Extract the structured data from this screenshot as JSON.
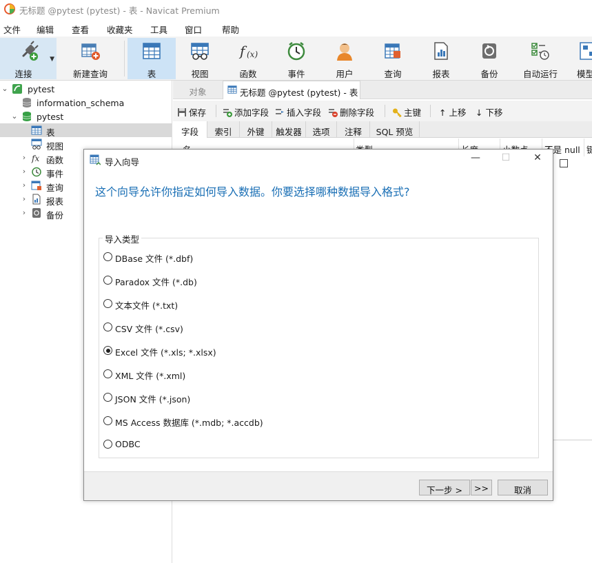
{
  "window": {
    "title": "无标题 @pytest (pytest) - 表 - Navicat Premium"
  },
  "menu": [
    "文件",
    "编辑",
    "查看",
    "收藏夹",
    "工具",
    "窗口",
    "帮助"
  ],
  "toolbar": {
    "connect": "连接",
    "new_query": "新建查询",
    "table": "表",
    "view": "视图",
    "function": "函数",
    "event": "事件",
    "user": "用户",
    "query": "查询",
    "report": "报表",
    "backup": "备份",
    "auto_run": "自动运行",
    "model": "模型"
  },
  "sidebar": {
    "conn": "pytest",
    "schema1": "information_schema",
    "schema2": "pytest",
    "table": "表",
    "view": "视图",
    "function": "函数",
    "event": "事件",
    "query": "查询",
    "report": "报表",
    "backup": "备份"
  },
  "tabs": {
    "objects": "对象",
    "doc": "无标题 @pytest (pytest) - 表"
  },
  "design_toolbar": {
    "save": "保存",
    "add_field": "添加字段",
    "insert_field": "插入字段",
    "delete_field": "删除字段",
    "primary_key": "主键",
    "move_up": "上移",
    "move_down": "下移"
  },
  "design_tabs": [
    "字段",
    "索引",
    "外键",
    "触发器",
    "选项",
    "注释",
    "SQL 预览"
  ],
  "grid": {
    "col_name": "名",
    "col_type": "类型",
    "col_length": "长度",
    "col_decimal": "小数点",
    "col_notnull": "不是 null",
    "col_key": "键"
  },
  "dialog": {
    "title": "导入向导",
    "heading": "这个向导允许你指定如何导入数据。你要选择哪种数据导入格式?",
    "group_label": "导入类型",
    "options": [
      "DBase 文件 (*.dbf)",
      "Paradox 文件 (*.db)",
      "文本文件 (*.txt)",
      "CSV 文件 (*.csv)",
      "Excel 文件 (*.xls; *.xlsx)",
      "XML 文件 (*.xml)",
      "JSON 文件 (*.json)",
      "MS Access 数据库 (*.mdb; *.accdb)",
      "ODBC"
    ],
    "selected_option": "Excel 文件 (*.xls; *.xlsx)",
    "next": "下一步 >",
    "finish": ">>",
    "cancel": "取消",
    "minimize": "—",
    "maximize": "☐",
    "close": "✕"
  },
  "colors": {
    "accent_blue": "#1a6fb5",
    "toolbar_active": "#cde3f6",
    "selected_row": "#d9d9d9"
  }
}
